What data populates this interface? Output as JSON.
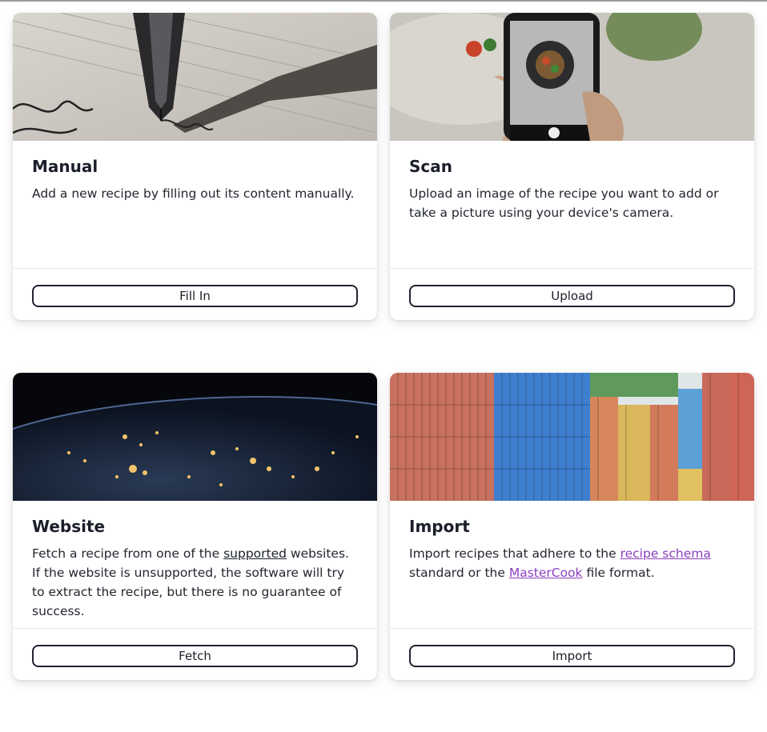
{
  "cards": [
    {
      "title": "Manual",
      "description": "Add a new recipe by filling out its content manually.",
      "button_label": "Fill In",
      "image_icon": "pen-writing-image"
    },
    {
      "title": "Scan",
      "description": "Upload an image of the recipe you want to add or take a picture using your device's camera.",
      "button_label": "Upload",
      "image_icon": "phone-camera-image"
    },
    {
      "title": "Website",
      "description_before": "Fetch a recipe from one of the ",
      "link_text": "supported",
      "description_after": " websites. If the website is unsupported, the software will try to extract the recipe, but there is no guarantee of success.",
      "button_label": "Fetch",
      "image_icon": "earth-night-image"
    },
    {
      "title": "Import",
      "description_before": "Import recipes that adhere to the ",
      "link1_text": "recipe schema",
      "description_middle": " standard or the ",
      "link2_text": "MasterCook",
      "description_after": " file format.",
      "button_label": "Import",
      "image_icon": "shipping-containers-image"
    }
  ],
  "colors": {
    "text": "#1b1f2a",
    "link_visited": "#8a3fbf",
    "border": "#1f2430"
  }
}
